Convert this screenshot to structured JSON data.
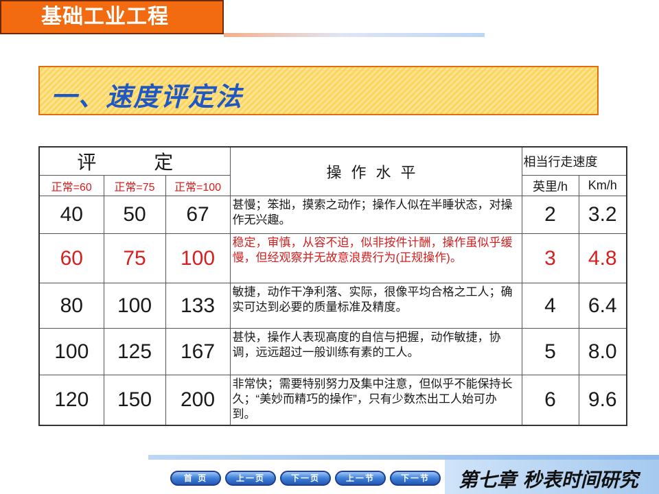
{
  "header": {
    "course_title": "基础工业工程"
  },
  "slide": {
    "title": "一、速度评定法"
  },
  "table": {
    "header_rating": "评　定",
    "header_operation": "操作水平",
    "header_speed": "相当行走速度",
    "sub_headers": [
      "正常=60",
      "正常=75",
      "正常=100"
    ],
    "unit_headers": [
      "英里/h",
      "Km/h"
    ],
    "rows": [
      {
        "r60": "40",
        "r75": "50",
        "r100": "67",
        "desc": "甚慢；笨拙，摸索之动作；操作人似在半睡状态，对操作无兴趣。",
        "mph": "2",
        "kmh": "3.2"
      },
      {
        "r60": "60",
        "r75": "75",
        "r100": "100",
        "desc": "稳定，审慎，从容不迫，似非按件计酬，操作虽似乎缓慢，但经观察并无故意浪费行为(正规操作)。",
        "mph": "3",
        "kmh": "4.8"
      },
      {
        "r60": "80",
        "r75": "100",
        "r100": "133",
        "desc": "敏捷，动作干净利落、实际，很像平均合格之工人；确实可达到必要的质量标准及精度。",
        "mph": "4",
        "kmh": "6.4"
      },
      {
        "r60": "100",
        "r75": "125",
        "r100": "167",
        "desc": "甚快，操作人表现高度的自信与把握，动作敏捷，协调，远远超过一般训练有素的工人。",
        "mph": "5",
        "kmh": "8.0"
      },
      {
        "r60": "120",
        "r75": "150",
        "r100": "200",
        "desc": "非常快；需要特别努力及集中注意，但似乎不能保持长久；“美妙而精巧的操作”，只有少数杰出工人始可办到。",
        "mph": "6",
        "kmh": "9.6"
      }
    ],
    "highlight_color": "#d42020"
  },
  "nav": {
    "buttons": [
      "首 页",
      "上一页",
      "下一页",
      "上一节",
      "下一节"
    ]
  },
  "footer": {
    "chapter": "第七章 秒表时间研究"
  }
}
